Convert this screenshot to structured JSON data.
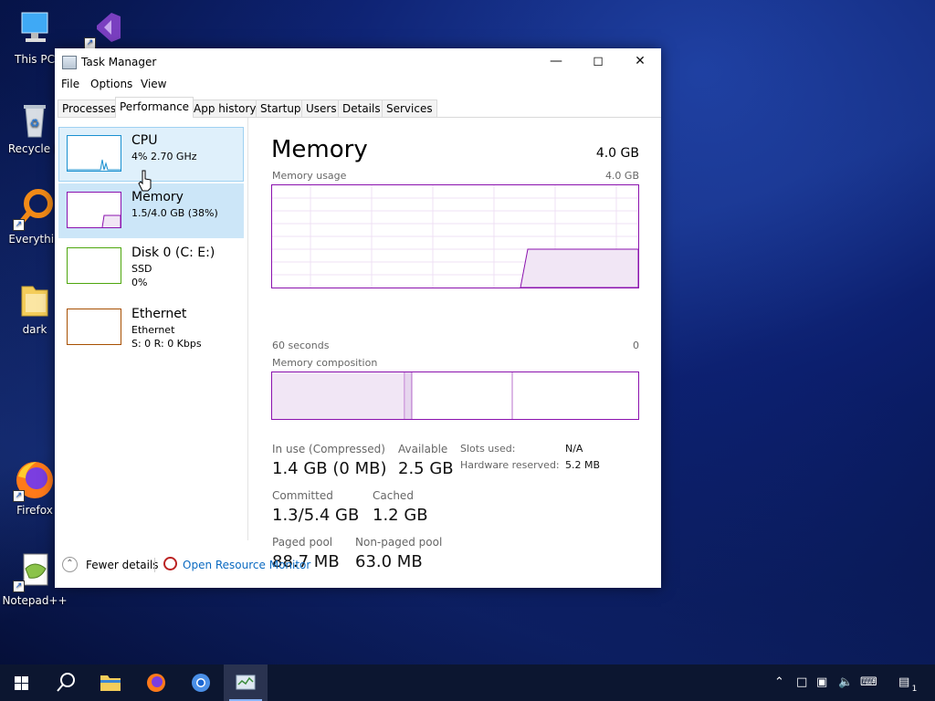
{
  "desktop": {
    "icons": [
      {
        "label": "This PC"
      },
      {
        "label": "Recycle B"
      },
      {
        "label": "Everythin"
      },
      {
        "label": "dark"
      },
      {
        "label": "Firefox"
      },
      {
        "label": "Notepad++"
      }
    ]
  },
  "window": {
    "title": "Task Manager",
    "menu": [
      "File",
      "Options",
      "View"
    ],
    "tabs": [
      "Processes",
      "Performance",
      "App history",
      "Startup",
      "Users",
      "Details",
      "Services"
    ],
    "active_tab": "Performance"
  },
  "resources": [
    {
      "name": "CPU",
      "line1": "4%  2.70 GHz",
      "line2": "",
      "color": "#1a90d0"
    },
    {
      "name": "Memory",
      "line1": "1.5/4.0 GB (38%)",
      "line2": "",
      "color": "#8b12ae"
    },
    {
      "name": "Disk 0 (C: E:)",
      "line1": "SSD",
      "line2": "0%",
      "color": "#4da60c"
    },
    {
      "name": "Ethernet",
      "line1": "Ethernet",
      "line2": "S: 0  R: 0 Kbps",
      "color": "#a74f01"
    }
  ],
  "detail": {
    "title": "Memory",
    "total": "4.0 GB",
    "usage_label": "Memory usage",
    "usage_max": "4.0 GB",
    "time_left": "60 seconds",
    "time_right": "0",
    "composition_label": "Memory composition",
    "stats": {
      "in_use_label": "In use (Compressed)",
      "in_use_value": "1.4 GB (0 MB)",
      "available_label": "Available",
      "available_value": "2.5 GB",
      "committed_label": "Committed",
      "committed_value": "1.3/5.4 GB",
      "cached_label": "Cached",
      "cached_value": "1.2 GB",
      "paged_label": "Paged pool",
      "paged_value": "88.7 MB",
      "nonpaged_label": "Non-paged pool",
      "nonpaged_value": "63.0 MB",
      "slots_label": "Slots used:",
      "slots_value": "N/A",
      "hw_label": "Hardware reserved:",
      "hw_value": "5.2 MB"
    }
  },
  "footer": {
    "fewer_details": "Fewer details",
    "open_resource_monitor": "Open Resource Monitor"
  },
  "taskbar": {
    "notification_count": "1"
  },
  "colors": {
    "memory_accent": "#8b12ae",
    "link": "#0b6ac1"
  }
}
